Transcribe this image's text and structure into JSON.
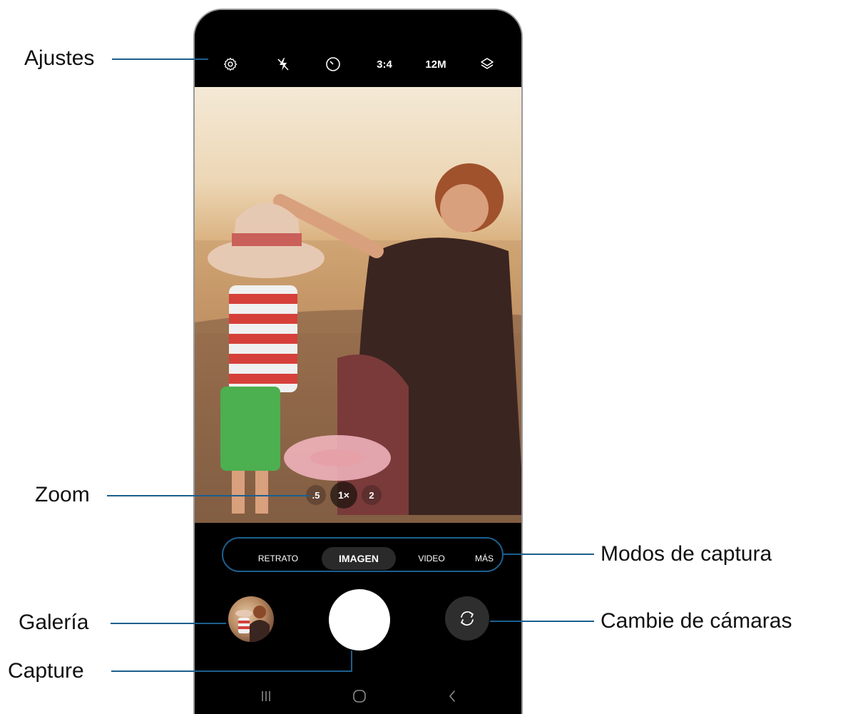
{
  "camera": {
    "top_bar": {
      "icons": [
        "gear-icon",
        "flash-off-icon",
        "timer-icon",
        "layers-icon"
      ],
      "aspect_ratio": "3:4",
      "resolution": "12M"
    },
    "zoom": {
      "levels": [
        ".5",
        "1×",
        "2"
      ],
      "selected": "1×"
    },
    "modes": {
      "items": [
        "RETRATO",
        "IMAGEN",
        "VIDEO",
        "MÁS"
      ],
      "selected": "IMAGEN"
    }
  },
  "callouts": {
    "settings": "Ajustes",
    "zoom": "Zoom",
    "capture_modes": "Modos de captura",
    "gallery": "Galería",
    "switch_cameras": "Cambie de cámaras",
    "capture": "Capture"
  },
  "colors": {
    "callout_line": "#1c5f8f",
    "mode_active_bg": "#2a2a2a"
  }
}
